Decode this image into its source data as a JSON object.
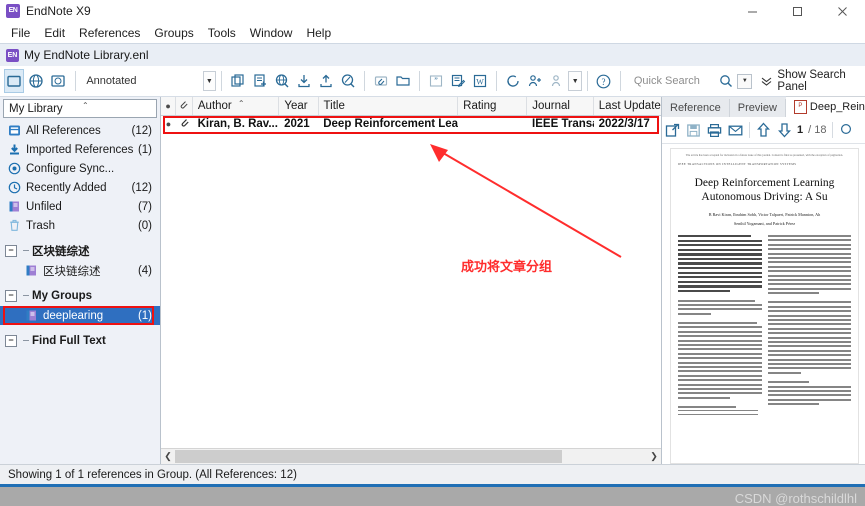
{
  "window": {
    "app_title": "EndNote X9",
    "app_icon": "endnote-icon",
    "minimize": "–",
    "maximize": "□",
    "close": "✕"
  },
  "menubar": {
    "items": [
      "File",
      "Edit",
      "References",
      "Groups",
      "Tools",
      "Window",
      "Help"
    ]
  },
  "library_tab": {
    "title": "My EndNote Library.enl",
    "icon": "endnote-icon"
  },
  "toolbar": {
    "style": "Annotated",
    "style_dropdown_caret": "▼",
    "quick_search_placeholder": "Quick Search",
    "show_search_panel": "Show Search Panel",
    "icons": [
      "local-library-icon",
      "online-search-icon",
      "integrated-library-icon",
      "copy-references-icon",
      "new-reference-icon",
      "online-search-globe-icon",
      "import-icon",
      "export-icon",
      "find-full-text-icon",
      "attach-file-icon",
      "open-file-icon",
      "quote-icon",
      "edit-reference-icon",
      "insert-citation-word-icon",
      "sync-icon",
      "share-library-icon",
      "manage-attachments-icon",
      "help-icon",
      "search-icon",
      "search-options-caret-icon",
      "double-chevron-down-icon"
    ]
  },
  "sidebar": {
    "header": "My Library",
    "items": [
      {
        "label": "All References",
        "count": "(12)",
        "icon": "all-references-icon",
        "type": "item"
      },
      {
        "label": "Imported References",
        "count": "(1)",
        "icon": "imported-references-icon",
        "type": "item"
      },
      {
        "label": "Configure Sync...",
        "count": "",
        "icon": "configure-sync-icon",
        "type": "item"
      },
      {
        "label": "Recently Added",
        "count": "(12)",
        "icon": "recently-added-icon",
        "type": "item"
      },
      {
        "label": "Unfiled",
        "count": "(7)",
        "icon": "unfiled-icon",
        "type": "item"
      },
      {
        "label": "Trash",
        "count": "(0)",
        "icon": "trash-icon",
        "type": "item"
      }
    ],
    "group_sets": [
      {
        "name": "区块链综述",
        "groups": [
          {
            "label": "区块链综述",
            "count": "(4)",
            "icon": "group-icon",
            "selected": false
          }
        ]
      },
      {
        "name": "My Groups",
        "groups": [
          {
            "label": "deeplearing",
            "count": "(1)",
            "icon": "group-icon",
            "selected": true
          }
        ]
      }
    ],
    "find_full_text": "Find Full Text"
  },
  "reference_list": {
    "columns": [
      {
        "label": "",
        "name": "read-status-column",
        "icon": "dot-icon"
      },
      {
        "label": "",
        "name": "attachment-column",
        "icon": "paperclip-icon"
      },
      {
        "label": "Author",
        "name": "author-column",
        "sorted": true
      },
      {
        "label": "Year",
        "name": "year-column"
      },
      {
        "label": "Title",
        "name": "title-column"
      },
      {
        "label": "Rating",
        "name": "rating-column"
      },
      {
        "label": "Journal",
        "name": "journal-column"
      },
      {
        "label": "Last Updated",
        "name": "last-updated-column"
      }
    ],
    "rows": [
      {
        "read": "●",
        "attachment": "paperclip-icon",
        "author": "Kiran, B. Rav...",
        "year": "2021",
        "title": "Deep Reinforcement Learning for A...",
        "rating": "",
        "journal": "IEEE Transa...",
        "last_updated": "2022/3/17",
        "selected": true
      }
    ]
  },
  "right_panel": {
    "tabs": [
      {
        "label": "Reference",
        "active": false
      },
      {
        "label": "Preview",
        "active": false
      },
      {
        "label": "Deep_Reinforcement_Lear",
        "active": true,
        "icon": "pdf-icon"
      }
    ],
    "pdf_toolbar": {
      "icons": [
        "open-external-icon",
        "save-icon",
        "print-icon",
        "email-icon",
        "previous-page-icon",
        "next-page-icon"
      ],
      "current_page": "1",
      "total_pages": "/ 18"
    },
    "pdf_preview": {
      "accept_note": "The article has been accepted for inclusion in a future issue of this journal. Content is final as presented, with the exception of pagination.",
      "running_head": "IEEE TRANSACTIONS ON INTELLIGENT TRANSPORTATION SYSTEMS",
      "title_line1": "Deep Reinforcement Learning",
      "title_line2": "Autonomous Driving: A Su",
      "authors_line1": "B Ravi Kiran, Ibrahim Sobh, Victor Talpaert, Patrick Mannion, Ah",
      "authors_line2": "Senthil Yogamani, and Patrick Pérez"
    }
  },
  "status_bar": {
    "text": "Showing 1 of 1 references in Group. (All References: 12)"
  },
  "annotations": {
    "callout_text": "成功将文章分组",
    "arrow_color": "#ff2d2d"
  },
  "watermark": {
    "text": "CSDN @rothschildlhl"
  },
  "colors": {
    "selection_blue": "#2f6fc0",
    "annotation_red": "#ff2d2d",
    "accent_blue": "#1f6fb5",
    "toolbar_icon": "#2a6a96"
  }
}
